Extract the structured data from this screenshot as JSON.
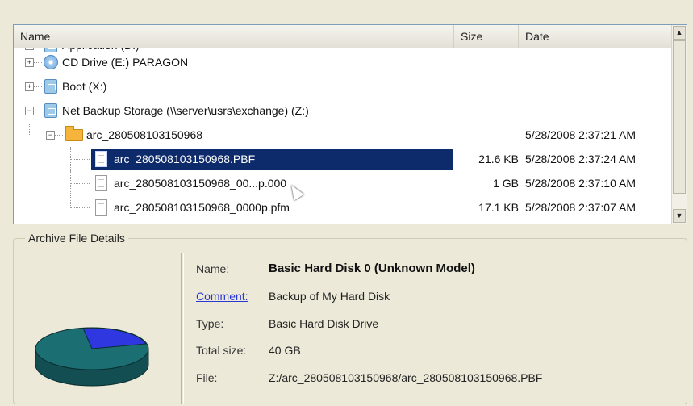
{
  "list": {
    "columns": {
      "name": "Name",
      "size": "Size",
      "date": "Date"
    },
    "rows": [
      {
        "label": "Application (D:)",
        "size": "",
        "date": "",
        "icon": "drive-icon"
      },
      {
        "label": "CD Drive (E:) PARAGON",
        "size": "",
        "date": "",
        "icon": "cd-drive-icon"
      },
      {
        "label": "Boot (X:)",
        "size": "",
        "date": "",
        "icon": "drive-icon"
      },
      {
        "label": "Net Backup Storage (\\\\server\\usrs\\exchange) (Z:)",
        "size": "",
        "date": "",
        "icon": "network-drive-icon"
      },
      {
        "label": "arc_280508103150968",
        "size": "",
        "date": "5/28/2008 2:37:21 AM",
        "icon": "folder-icon"
      },
      {
        "label": "arc_280508103150968.PBF",
        "size": "21.6 KB",
        "date": "5/28/2008 2:37:24 AM",
        "icon": "file-icon"
      },
      {
        "label": "arc_280508103150968_00...p.000",
        "size": "1 GB",
        "date": "5/28/2008 2:37:10 AM",
        "icon": "file-icon"
      },
      {
        "label": "arc_280508103150968_0000p.pfm",
        "size": "17.1 KB",
        "date": "5/28/2008 2:37:07 AM",
        "icon": "file-icon"
      }
    ],
    "scroll_up": "▲",
    "scroll_down": "▼"
  },
  "details": {
    "title": "Archive File Details",
    "fields": [
      {
        "label": "Name:",
        "value": "Basic Hard Disk 0 (Unknown Model)"
      },
      {
        "label": "Comment:",
        "value": "Backup of My Hard Disk"
      },
      {
        "label": "Type:",
        "value": "Basic Hard Disk Drive"
      },
      {
        "label": "Total size:",
        "value": "40 GB"
      },
      {
        "label": "File:",
        "value": "Z:/arc_280508103150968/arc_280508103150968.PBF"
      }
    ]
  },
  "colors": {
    "selection": "#0d2a6b",
    "pie_used": "#1b6f72",
    "pie_free": "#2f38e0",
    "link": "#2b39d4"
  }
}
